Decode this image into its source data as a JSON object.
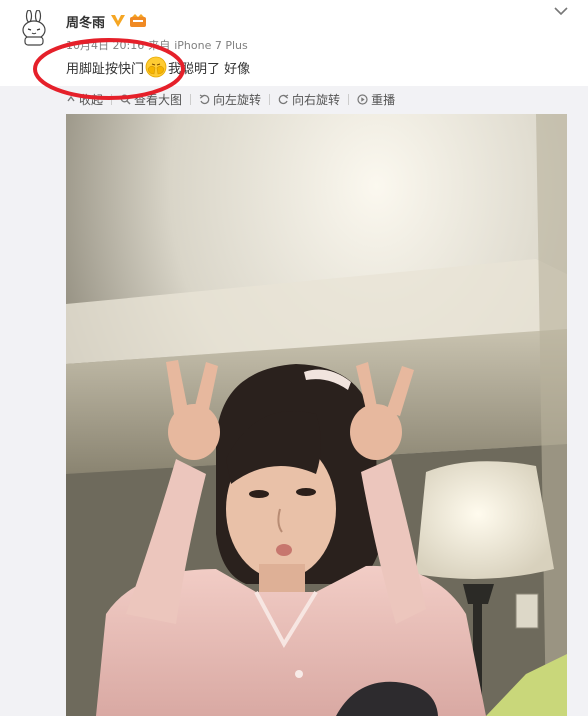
{
  "post": {
    "username": "周冬雨",
    "timestamp": "10月4日 20:16",
    "source_prefix": "来自",
    "device": "iPhone 7 Plus",
    "text_before_emoji": "用脚趾按快门",
    "text_after_emoji": "我聪明了 好像",
    "emoji": "hiding-face-emoji"
  },
  "toolbar": {
    "collapse_label": "收起",
    "view_large_label": "查看大图",
    "rotate_left_label": "向左旋转",
    "rotate_right_label": "向右旋转",
    "replay_label": "重播"
  },
  "icons": {
    "avatar": "rabbit-avatar-icon",
    "verified": "verified-v-icon",
    "member": "member-badge-icon",
    "menu": "chevron-down-icon"
  },
  "colors": {
    "annotation": "#e5202a",
    "verified": "#f5a623",
    "link_text": "#333333",
    "meta_text": "#808080"
  }
}
